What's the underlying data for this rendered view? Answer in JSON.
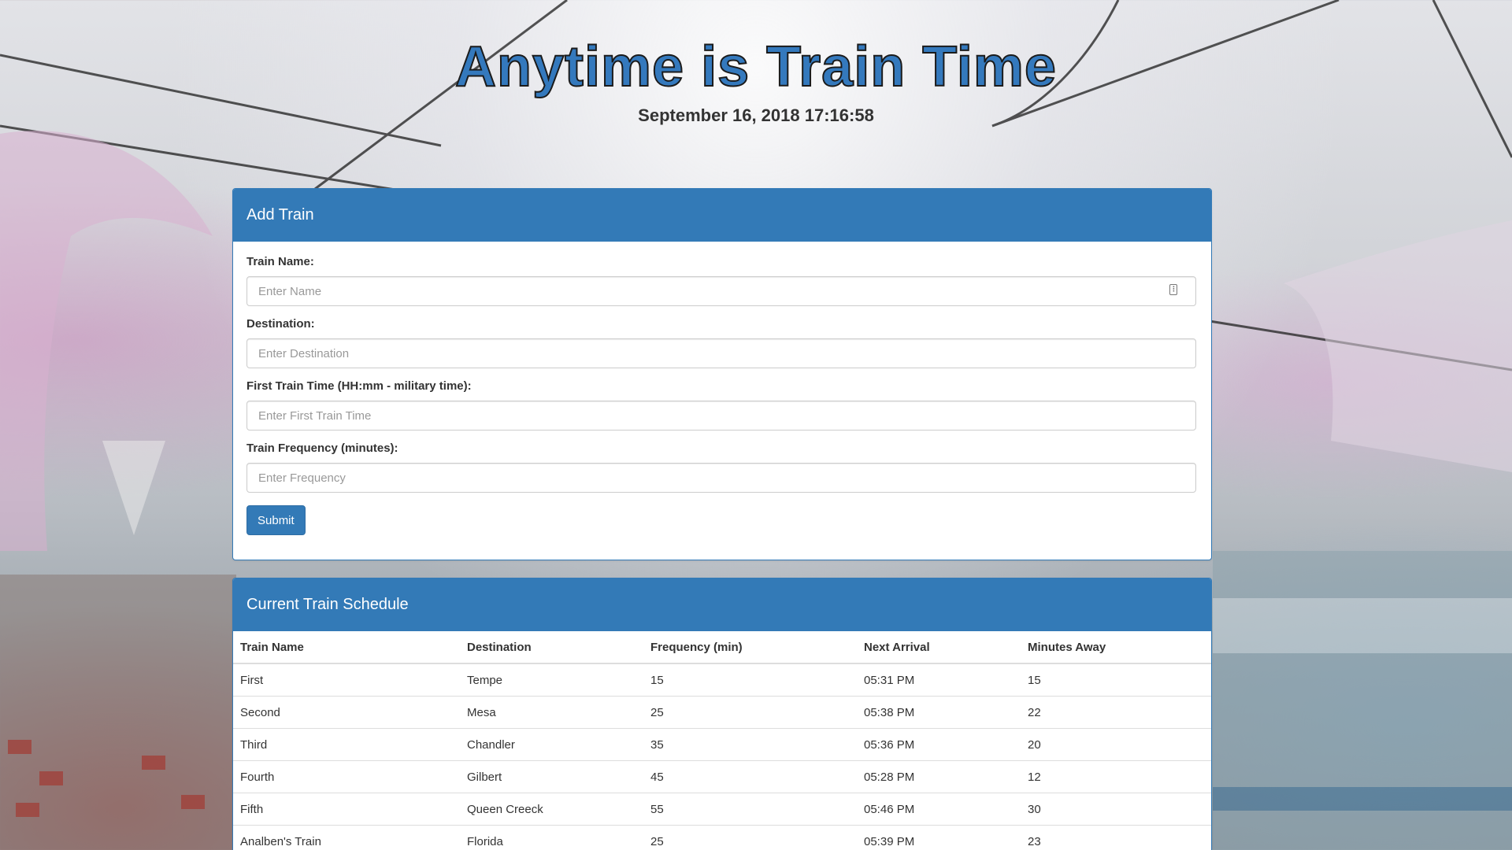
{
  "header": {
    "title": "Anytime is Train Time",
    "clock": "September 16, 2018 17:16:58"
  },
  "add_train": {
    "heading": "Add Train",
    "fields": [
      {
        "label": "Train Name:",
        "placeholder": "Enter Name",
        "value": ""
      },
      {
        "label": "Destination:",
        "placeholder": "Enter Destination",
        "value": ""
      },
      {
        "label": "First Train Time (HH:mm - military time):",
        "placeholder": "Enter First Train Time",
        "value": ""
      },
      {
        "label": "Train Frequency (minutes):",
        "placeholder": "Enter Frequency",
        "value": ""
      }
    ],
    "submit_label": "Submit"
  },
  "schedule": {
    "heading": "Current Train Schedule",
    "columns": [
      "Train Name",
      "Destination",
      "Frequency (min)",
      "Next Arrival",
      "Minutes Away"
    ],
    "rows": [
      [
        "First",
        "Tempe",
        "15",
        "05:31 PM",
        "15"
      ],
      [
        "Second",
        "Mesa",
        "25",
        "05:38 PM",
        "22"
      ],
      [
        "Third",
        "Chandler",
        "35",
        "05:36 PM",
        "20"
      ],
      [
        "Fourth",
        "Gilbert",
        "45",
        "05:28 PM",
        "12"
      ],
      [
        "Fifth",
        "Queen Creeck",
        "55",
        "05:46 PM",
        "30"
      ],
      [
        "Analben's Train",
        "Florida",
        "25",
        "05:39 PM",
        "23"
      ]
    ]
  },
  "colors": {
    "primary": "#337ab7",
    "title_fill": "#3479bd",
    "title_outline": "#1b1b1b"
  },
  "icons": {
    "name_field_icon": "contact-card-icon"
  }
}
